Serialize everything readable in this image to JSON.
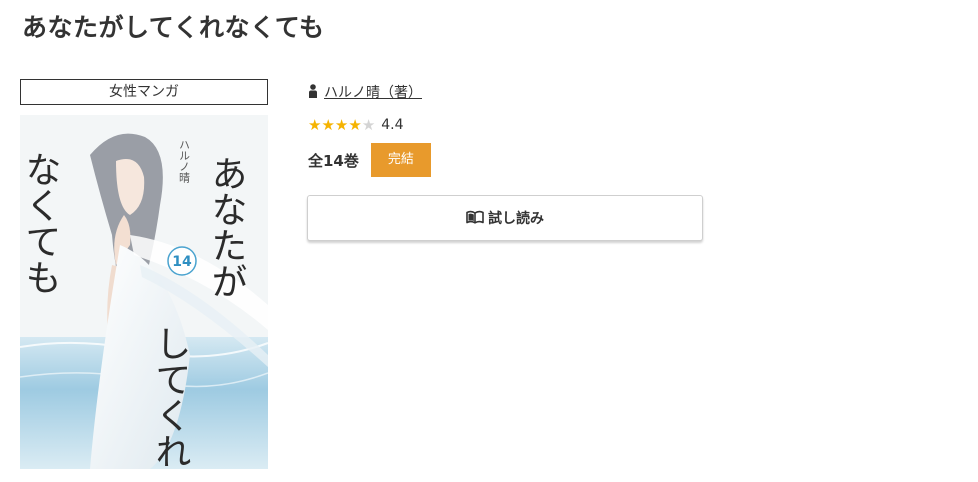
{
  "page": {
    "title": "あなたがしてくれなくても"
  },
  "genre": {
    "label": "女性マンガ"
  },
  "cover": {
    "title_vertical": [
      "あなたが",
      "してくれ",
      "なくても"
    ],
    "author_vertical": "ハルノ晴",
    "volume_number": "14"
  },
  "author": {
    "icon": "person-icon",
    "label": "ハルノ晴（著）"
  },
  "rating": {
    "stars_filled": 4,
    "stars_total": 5,
    "value": "4.4",
    "star_color": "#f5b301"
  },
  "volumes": {
    "count_label": "全14巻",
    "status_label": "完結",
    "status_color": "#e89a2c"
  },
  "trial": {
    "icon": "open-book-icon",
    "label": "試し読み"
  }
}
